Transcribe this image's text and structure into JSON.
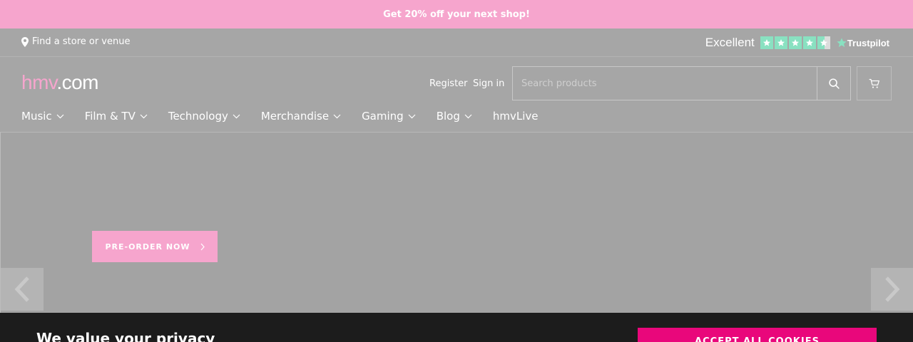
{
  "promo": {
    "text": "Get 20% off your next shop!"
  },
  "utility": {
    "store_link": "Find a store or venue",
    "trustpilot": {
      "label": "Excellent",
      "rating_stars": 4.5,
      "brand": "Trustpilot"
    }
  },
  "header": {
    "logo": {
      "part1": "hmv",
      "part2": ".com"
    },
    "register": "Register",
    "sign_in": "Sign in",
    "search_placeholder": "Search products"
  },
  "nav": {
    "items": [
      {
        "label": "Music",
        "dropdown": true
      },
      {
        "label": "Film & TV",
        "dropdown": true
      },
      {
        "label": "Technology",
        "dropdown": true
      },
      {
        "label": "Merchandise",
        "dropdown": true
      },
      {
        "label": "Gaming",
        "dropdown": true
      },
      {
        "label": "Blog",
        "dropdown": true
      },
      {
        "label": "hmvLive",
        "dropdown": false
      }
    ]
  },
  "hero": {
    "cta": "PRE-ORDER NOW"
  },
  "cookie": {
    "title": "We value your privacy",
    "accept": "ACCEPT ALL COOKIES"
  },
  "colors": {
    "brand_pink": "#f6a5cd",
    "accept_pink": "#e9077b",
    "trustpilot_green": "#89e1c1",
    "cookie_bg": "#1c1c1c"
  }
}
